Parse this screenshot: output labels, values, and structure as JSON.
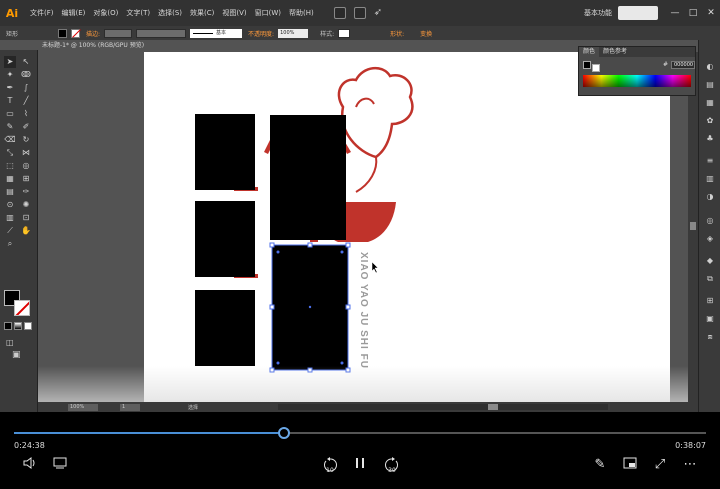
{
  "app": {
    "logo": "Ai",
    "menus": [
      "文件(F)",
      "编辑(E)",
      "对象(O)",
      "文字(T)",
      "选择(S)",
      "效果(C)",
      "视图(V)",
      "窗口(W)",
      "帮助(H)"
    ],
    "workspace": "基本功能",
    "window_controls": [
      "—",
      "□",
      "✕"
    ]
  },
  "control_bar": {
    "tool_label": "矩形",
    "stroke_label": "描边:",
    "stroke_style": "基本",
    "opacity_label": "不透明度:",
    "opacity_value": "100%",
    "style_label": "样式:",
    "shape_label": "形状:",
    "transform_label": "变换"
  },
  "document": {
    "tab_title": "未标题-1* @ 100% (RGB/GPU 预览)",
    "zoom": "100%",
    "artboard_number": "1",
    "status_text": "选择"
  },
  "color_panel": {
    "tabs": [
      "颜色",
      "颜色参考"
    ],
    "hex_value": "000000"
  },
  "artwork": {
    "vertical_text": "XIAO YAO JU  SHI FU",
    "accent_color": "#c0332b"
  },
  "player": {
    "current_time": "0:24:38",
    "total_time": "0:38:07",
    "progress": 0.39,
    "skip_back_seconds": "10",
    "skip_forward_seconds": "30",
    "progress_color": "#4a8fd6"
  },
  "tools": [
    "selection-tool-icon",
    "direct-selection-tool-icon",
    "magic-wand-icon",
    "lasso-icon",
    "pen-icon",
    "curvature-icon",
    "type-icon",
    "line-icon",
    "rectangle-icon",
    "paintbrush-icon",
    "pencil-icon",
    "shaper-icon",
    "eraser-icon",
    "rotate-icon",
    "scale-icon",
    "width-icon",
    "free-transform-icon",
    "shape-builder-icon",
    "perspective-icon",
    "mesh-icon",
    "gradient-icon",
    "eyedropper-icon",
    "blend-icon",
    "symbol-sprayer-icon",
    "graph-icon",
    "artboard-icon",
    "slice-icon",
    "hand-icon",
    "zoom-icon"
  ]
}
